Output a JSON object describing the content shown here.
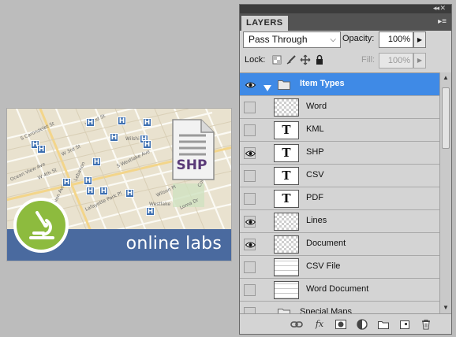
{
  "artwork": {
    "banner_text": "online labs",
    "file_icon_ext": "SHP",
    "hospital_marker": "H",
    "map_labels": [
      "S Carondelet St",
      "W 2nd St",
      "W 3rd St",
      "W 4th St",
      "Ocean View Ave",
      "S Westlake Ave",
      "Wilshire",
      "Westlake",
      "Wilson Pl",
      "Lafayette Park Pl",
      "Loma Dr",
      "Union Ave",
      "Columbia Ave",
      "Lebanon"
    ],
    "colors": {
      "banner": "#4a6a9f",
      "badge": "#8dbb3e",
      "map": "#e9e2cf",
      "marker": "#3d6fb0"
    }
  },
  "panel": {
    "tab_title": "LAYERS",
    "collapse_icon": "double-chevron-icon",
    "menu_icon": "panel-menu-icon",
    "blend_mode": "Pass Through",
    "opacity_label": "Opacity:",
    "opacity_value": "100%",
    "lock_label": "Lock:",
    "fill_label": "Fill:",
    "fill_value": "100%",
    "selected_color": "#3f8ae6",
    "layers": [
      {
        "name": "Item Types",
        "kind": "group",
        "visible": true,
        "selected": true
      },
      {
        "name": "Word",
        "kind": "raster",
        "visible": false
      },
      {
        "name": "KML",
        "kind": "text",
        "visible": false
      },
      {
        "name": "SHP",
        "kind": "text",
        "visible": true
      },
      {
        "name": "CSV",
        "kind": "text",
        "visible": false
      },
      {
        "name": "PDF",
        "kind": "text",
        "visible": false
      },
      {
        "name": "Lines",
        "kind": "raster",
        "visible": true
      },
      {
        "name": "Document",
        "kind": "raster",
        "visible": true
      },
      {
        "name": "CSV File",
        "kind": "doc",
        "visible": false
      },
      {
        "name": "Word Document",
        "kind": "doc",
        "visible": false
      },
      {
        "name": "Special Maps",
        "kind": "group",
        "visible": false
      }
    ],
    "text_thumb_glyph": "T",
    "footer_buttons": [
      "link-layers-icon",
      "fx-icon",
      "mask-icon",
      "adjustment-icon",
      "new-group-icon",
      "new-layer-icon",
      "trash-icon"
    ],
    "footer_fx_label": "fx"
  }
}
